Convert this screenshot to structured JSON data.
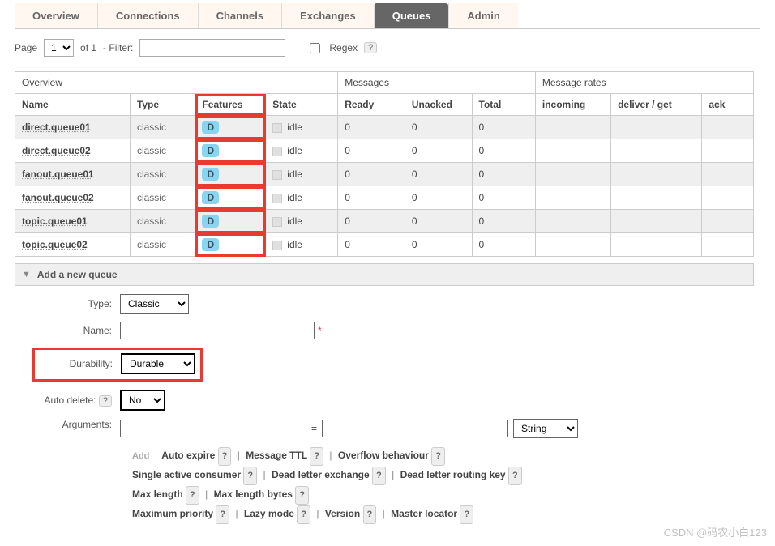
{
  "tabs": {
    "overview": "Overview",
    "connections": "Connections",
    "channels": "Channels",
    "exchanges": "Exchanges",
    "queues": "Queues",
    "admin": "Admin"
  },
  "pager": {
    "page_label": "Page",
    "page_value": "1",
    "of_label": "of 1",
    "filter_label": "- Filter:",
    "regex_label": "Regex",
    "hint": "?"
  },
  "table": {
    "groups": {
      "overview": "Overview",
      "messages": "Messages",
      "rates": "Message rates"
    },
    "cols": {
      "name": "Name",
      "type": "Type",
      "features": "Features",
      "state": "State",
      "ready": "Ready",
      "unacked": "Unacked",
      "total": "Total",
      "incoming": "incoming",
      "deliver": "deliver / get",
      "ack": "ack"
    },
    "feature_badge": "D",
    "state_text": "idle",
    "rows": [
      {
        "name": "direct.queue01",
        "type": "classic",
        "ready": "0",
        "unacked": "0",
        "total": "0"
      },
      {
        "name": "direct.queue02",
        "type": "classic",
        "ready": "0",
        "unacked": "0",
        "total": "0"
      },
      {
        "name": "fanout.queue01",
        "type": "classic",
        "ready": "0",
        "unacked": "0",
        "total": "0"
      },
      {
        "name": "fanout.queue02",
        "type": "classic",
        "ready": "0",
        "unacked": "0",
        "total": "0"
      },
      {
        "name": "topic.queue01",
        "type": "classic",
        "ready": "0",
        "unacked": "0",
        "total": "0"
      },
      {
        "name": "topic.queue02",
        "type": "classic",
        "ready": "0",
        "unacked": "0",
        "total": "0"
      }
    ]
  },
  "add_section": {
    "title": "Add a new queue"
  },
  "form": {
    "type_label": "Type:",
    "type_value": "Classic",
    "name_label": "Name:",
    "name_value": "",
    "durability_label": "Durability:",
    "durability_value": "Durable",
    "autodelete_label": "Auto delete:",
    "autodelete_hint": "?",
    "autodelete_value": "No",
    "arguments_label": "Arguments:",
    "arg_key": "",
    "arg_eq": "=",
    "arg_val": "",
    "arg_type": "String",
    "add_label": "Add",
    "extras": {
      "auto_expire": "Auto expire",
      "message_ttl": "Message TTL",
      "overflow": "Overflow behaviour",
      "single_active": "Single active consumer",
      "dlx": "Dead letter exchange",
      "dlrk": "Dead letter routing key",
      "max_len": "Max length",
      "max_len_bytes": "Max length bytes",
      "max_priority": "Maximum priority",
      "lazy": "Lazy mode",
      "version": "Version",
      "master_loc": "Master locator"
    },
    "hint": "?"
  },
  "watermark": "CSDN @码农小白123"
}
